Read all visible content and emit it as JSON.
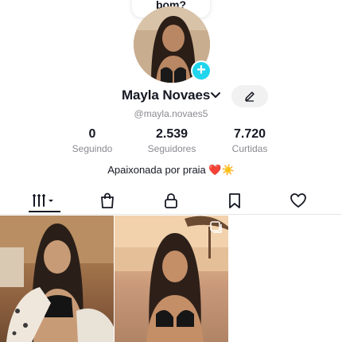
{
  "tooltip": {
    "text": "bom?"
  },
  "profile": {
    "username": "Mayla Novaes",
    "handle": "@mayla.novaes5",
    "bio": "Apaixonada por praia ❤️☀️"
  },
  "stats": [
    {
      "value": "0",
      "label": "Seguindo"
    },
    {
      "value": "2.539",
      "label": "Seguidores"
    },
    {
      "value": "7.720",
      "label": "Curtidas"
    }
  ],
  "tabs": [
    {
      "icon": "videos-grid-icon",
      "active": true
    },
    {
      "icon": "shop-bag-icon",
      "active": false
    },
    {
      "icon": "lock-icon",
      "active": false
    },
    {
      "icon": "bookmark-icon",
      "active": false
    },
    {
      "icon": "heart-icon",
      "active": false
    }
  ],
  "colors": {
    "accent": "#20d5ec",
    "text": "#161823",
    "muted": "#8a8b91",
    "heart": "#e8232f",
    "sun": "#f7b500"
  }
}
